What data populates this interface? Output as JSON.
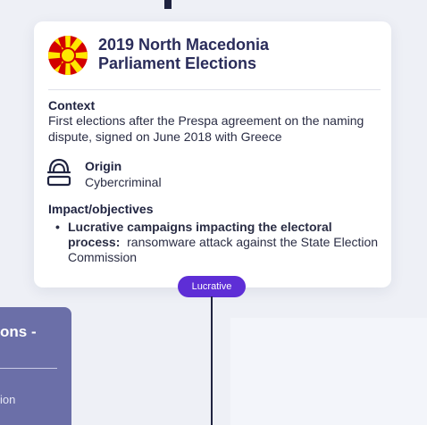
{
  "event": {
    "title_line1": "2019 North Macedonia",
    "title_line2": "Parliament Elections",
    "flag_icon": "north-macedonia-flag-icon"
  },
  "context": {
    "label": "Context",
    "text": "First elections after the Prespa agreement on the naming dispute, signed on June 2018 with Greece"
  },
  "origin": {
    "label": "Origin",
    "value": "Cybercriminal",
    "icon": "hooded-hacker-icon"
  },
  "impact": {
    "label": "Impact/objectives",
    "items": [
      {
        "strong": "Lucrative campaigns impacting the electoral process:",
        "text": "ransomware attack against the State Election Commission"
      }
    ]
  },
  "badge": {
    "label": "Lucrative",
    "color": "#5e2ed6"
  },
  "side_card": {
    "title": "ons -",
    "text": "ion",
    "color": "#6b6fa8"
  }
}
